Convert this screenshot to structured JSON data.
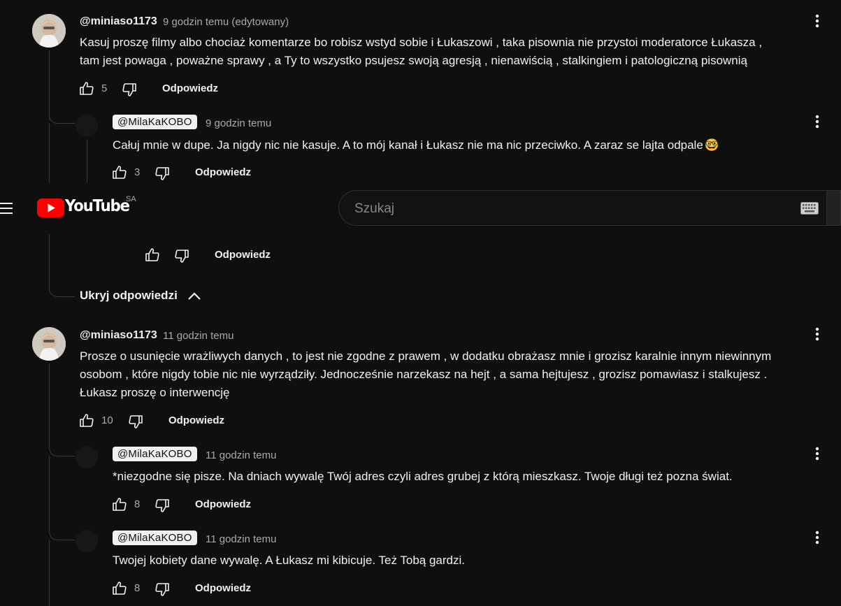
{
  "masthead": {
    "logo_text": "YouTube",
    "country_code": "SA",
    "search_placeholder": "Szukaj"
  },
  "colors": {
    "brand_red": "#ff0000",
    "background": "#0f0f0f",
    "badge_bg": "#f1f1f1"
  },
  "icons": {
    "menu": "hamburger-menu-icon",
    "like": "thumbs-up-icon",
    "dislike": "thumbs-down-icon",
    "more": "three-dots-vertical-icon",
    "keyboard": "keyboard-icon",
    "collapse": "chevron-up-icon",
    "emoji": "nerd-face-emoji"
  },
  "thread1": {
    "comment": {
      "author": "@miniaso1173",
      "time": "9 godzin temu (edytowany)",
      "line1": "Kasuj proszę filmy albo chociaż komentarze bo robisz wstyd sobie i Łukaszowi , taka pisownia nie przystoi moderatorce Łukasza ,",
      "line2": "tam jest powaga , poważne sprawy , a Ty to wszystko psujesz swoją agresją , nienawiścią , stalkingiem i patologiczną pisownią",
      "likes": "5",
      "reply_label": "Odpowiedz"
    },
    "reply1": {
      "author": "@MilaKaKOBO",
      "time": "9 godzin temu",
      "text": "Całuj mnie w dupe. Ja nigdy nic nie kasuje. A to mój kanał i Łukasz nie ma nic przeciwko. A zaraz se lajta odpale",
      "emoji": "🤓",
      "likes": "3",
      "reply_label": "Odpowiedz"
    },
    "reply2": {
      "reply_label": "Odpowiedz"
    },
    "hide_replies_label": "Ukryj odpowiedzi"
  },
  "thread2": {
    "comment": {
      "author": "@miniaso1173",
      "time": "11 godzin temu",
      "line1": "Prosze o usunięcie wrażliwych danych , to jest nie zgodne z prawem , w dodatku obrażasz mnie i grozisz karalnie innym niewinnym",
      "line2": "osobom , które nigdy tobie nic nie wyrządziły. Jednocześnie narzekasz na hejt , a sama hejtujesz , grozisz pomawiasz i stalkujesz .",
      "line3": "Łukasz proszę o interwencję",
      "likes": "10",
      "reply_label": "Odpowiedz"
    },
    "reply1": {
      "author": "@MilaKaKOBO",
      "time": "11 godzin temu",
      "text": "*niezgodne się pisze. Na dniach wywalę Twój adres czyli adres grubej z którą mieszkasz. Twoje długi też pozna świat.",
      "likes": "8",
      "reply_label": "Odpowiedz"
    },
    "reply2": {
      "author": "@MilaKaKOBO",
      "time": "11 godzin temu",
      "text": "Twojej kobiety dane wywalę. A Łukasz mi kibicuje. Też Tobą gardzi.",
      "likes": "8",
      "reply_label": "Odpowiedz"
    }
  }
}
